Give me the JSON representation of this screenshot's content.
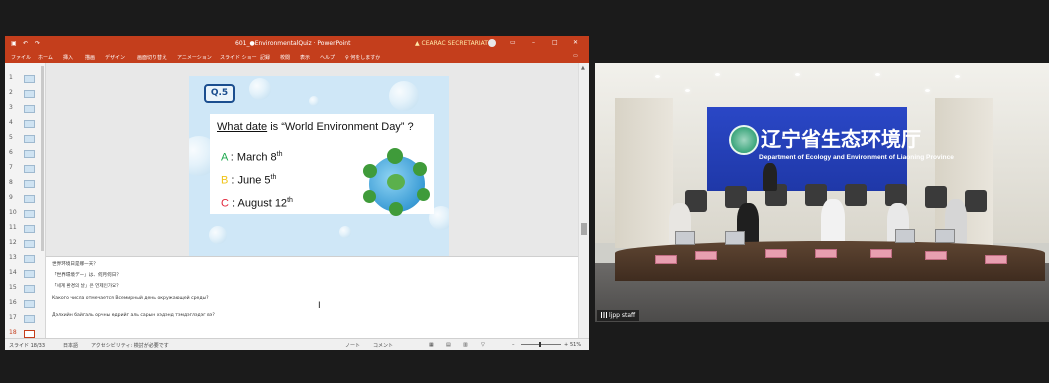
{
  "ppt": {
    "title": "601_●EnvironmentalQuiz · PowerPoint",
    "warning": "▲ CEARAC SECRETARIAT",
    "tabs": [
      "ファイル",
      "ホーム",
      "挿入",
      "描画",
      "デザイン",
      "画面切り替え",
      "アニメーション",
      "スライド ショー",
      "記録",
      "校閲",
      "表示",
      "ヘルプ",
      "♀ 何をしますか"
    ],
    "thumbnails": [
      "1",
      "2",
      "3",
      "4",
      "5",
      "6",
      "7",
      "8",
      "9",
      "10",
      "11",
      "12",
      "13",
      "14",
      "15",
      "16",
      "17",
      "18"
    ],
    "active_slide": "18",
    "slide": {
      "badge": "Q.5",
      "question_underlined": "What date",
      "question_rest": " is “World Environment Day” ?",
      "answers": [
        {
          "letter": "A",
          "text": " : March 8",
          "sup": "th",
          "color": "#1aa84b"
        },
        {
          "letter": "B",
          "text": " : June 5",
          "sup": "th",
          "color": "#f0c419"
        },
        {
          "letter": "C",
          "text": " : August 12",
          "sup": "th",
          "color": "#e2263b"
        }
      ]
    },
    "notes": [
      "世界环境日是哪一天？",
      "「世界環境デー」は、何月何日？",
      "「세계 환경의 날」은 언제인가요？",
      "Какого числа отмечается Всемирный день окружающей среды?",
      "Дэлхийн байгаль орчны өдрийг аль сарын хэдэнд тэмдэглэдэг вэ?"
    ],
    "status": {
      "slide_count": "スライド 18/33",
      "language": "日本語",
      "accessibility": "アクセシビリティ: 検討が必要です",
      "notes_btn": "ノート",
      "comments_btn": "コメント",
      "zoom": "51%"
    }
  },
  "video": {
    "banner_cn": "辽宁省生态环境厅",
    "banner_en": "Department of Ecology and Environment of Liaoning Province",
    "participant": "ljpp staff"
  }
}
